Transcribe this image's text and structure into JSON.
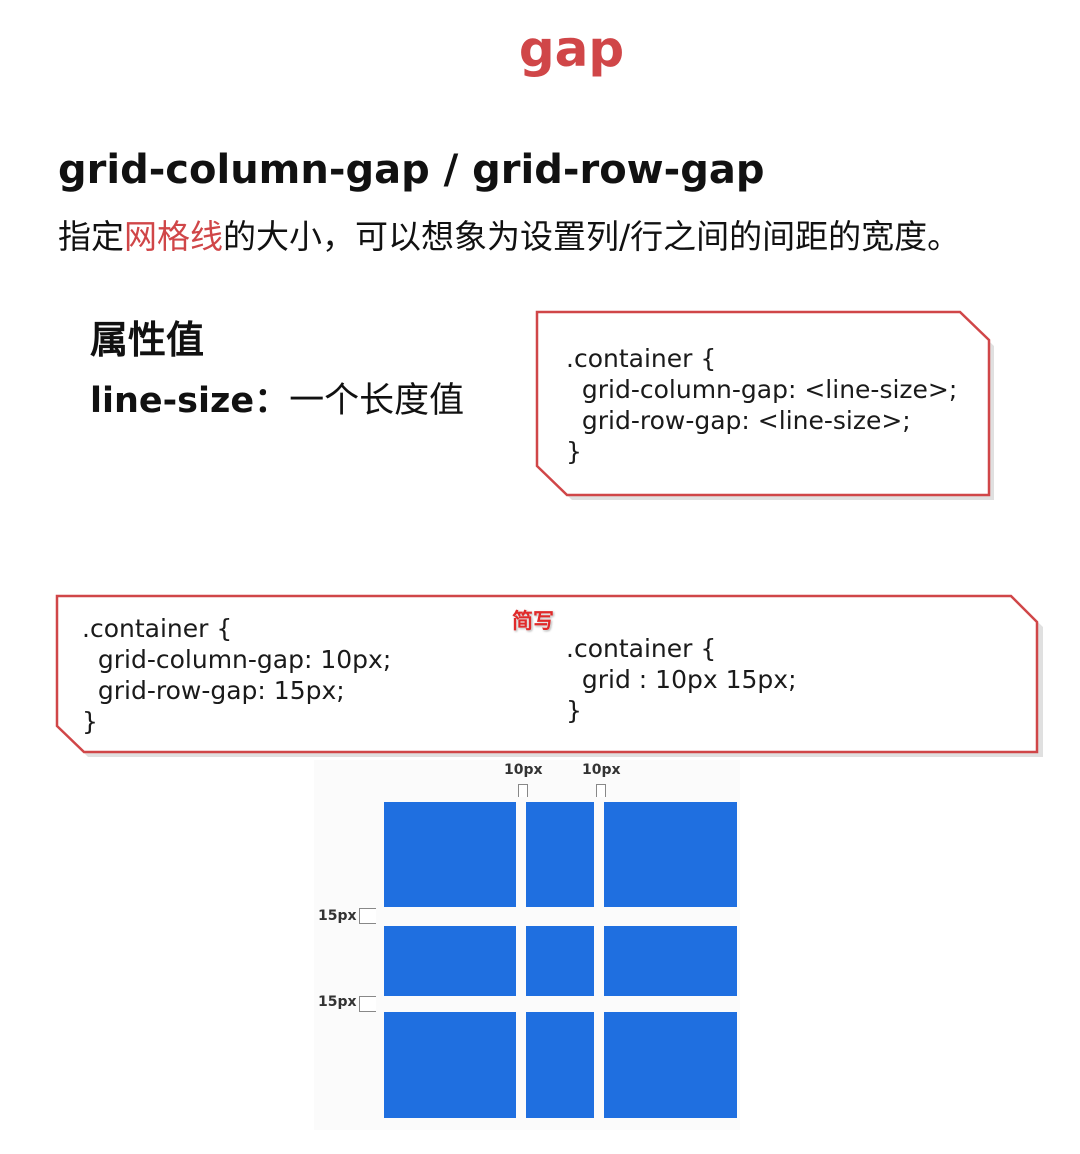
{
  "title": "gap",
  "heading": "grid-column-gap / grid-row-gap",
  "description": {
    "prefix": "指定",
    "highlight": "网格线",
    "suffix": "的大小，可以想象为设置列/行之间的间距的宽度。"
  },
  "property": {
    "title": "属性值",
    "key": "line-size",
    "separator": "：",
    "value": "一个长度值"
  },
  "syntax_code": ".container {\n  grid-column-gap: <line-size>;\n  grid-row-gap: <line-size>;\n}",
  "example": {
    "long_code": ".container {\n  grid-column-gap: 10px;\n  grid-row-gap: 15px;\n}",
    "shorthand_tag": "简写",
    "short_code": ".container {\n  grid : 10px 15px;\n}"
  },
  "demo": {
    "column_gap_label_1": "10px",
    "column_gap_label_2": "10px",
    "row_gap_label_1": "15px",
    "row_gap_label_2": "15px",
    "cell_color": "#1f6fe0"
  },
  "colors": {
    "accent": "#d04648",
    "box_border": "#d04648"
  }
}
